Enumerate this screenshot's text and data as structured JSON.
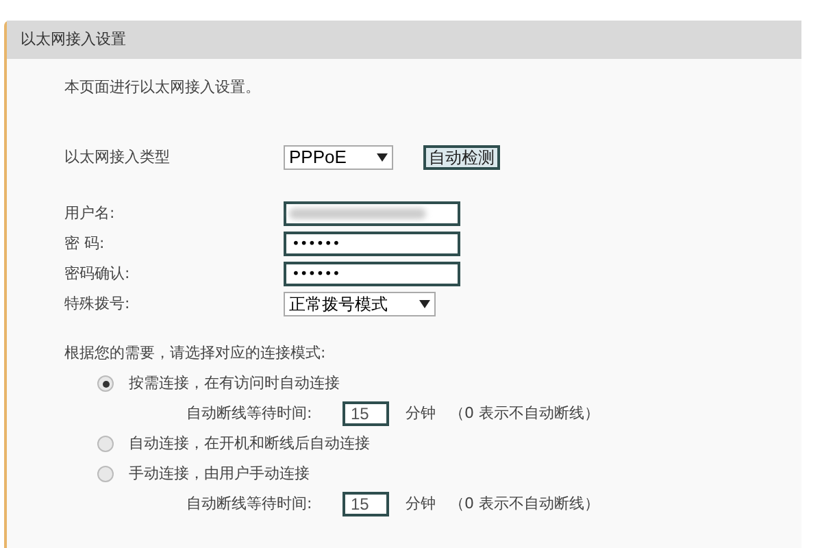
{
  "panel": {
    "title": "以太网接入设置",
    "description": "本页面进行以太网接入设置。"
  },
  "connection_type": {
    "label": "以太网接入类型",
    "value": "PPPoE",
    "detect_button": "自动检测"
  },
  "fields": [
    {
      "kind": "blurred",
      "label": "用户名:"
    },
    {
      "kind": "password",
      "label": "密 码:",
      "value": "••••••"
    },
    {
      "kind": "password",
      "label": "密码确认:",
      "value": "••••••"
    },
    {
      "kind": "select",
      "label": "特殊拨号:",
      "value": "正常拨号模式"
    }
  ],
  "modes": {
    "prompt": "根据您的需要，请选择对应的连接模式:",
    "options": [
      {
        "label": "按需连接，在有访问时自动连接",
        "selected": true,
        "wait": {
          "label": "自动断线等待时间:",
          "value": "15",
          "unit": "分钟",
          "note": "（0 表示不自动断线）"
        }
      },
      {
        "label": "自动连接，在开机和断线后自动连接",
        "selected": false
      },
      {
        "label": "手动连接，由用户手动连接",
        "selected": false,
        "wait": {
          "label": "自动断线等待时间:",
          "value": "15",
          "unit": "分钟",
          "note": "（0 表示不自动断线）"
        }
      }
    ]
  }
}
